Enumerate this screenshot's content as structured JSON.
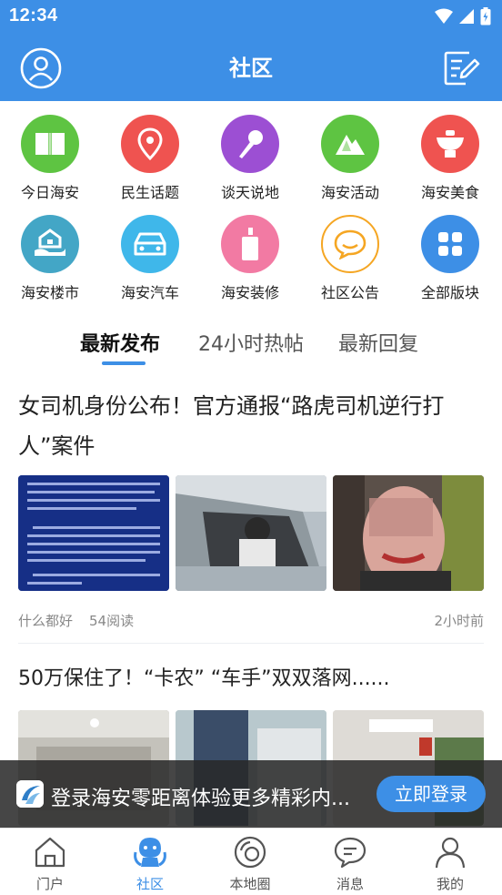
{
  "status_bar": {
    "time": "12:34"
  },
  "header": {
    "title": "社区"
  },
  "categories": [
    {
      "label": "今日海安",
      "icon": "book-icon",
      "color": "#5ec442"
    },
    {
      "label": "民生话题",
      "icon": "location-pin-icon",
      "color": "#ef5350"
    },
    {
      "label": "谈天说地",
      "icon": "microphone-icon",
      "color": "#9c4fd3"
    },
    {
      "label": "海安活动",
      "icon": "mountain-icon",
      "color": "#5ec442"
    },
    {
      "label": "海安美食",
      "icon": "food-bowl-icon",
      "color": "#ef5350"
    },
    {
      "label": "海安楼市",
      "icon": "house-hand-icon",
      "color": "#43a6c6"
    },
    {
      "label": "海安汽车",
      "icon": "car-icon",
      "color": "#3fb7ea"
    },
    {
      "label": "海安装修",
      "icon": "paint-tube-icon",
      "color": "#f27aa3"
    },
    {
      "label": "社区公告",
      "icon": "chat-bubble-icon",
      "color": "#f5a623"
    },
    {
      "label": "全部版块",
      "icon": "grid-icon",
      "color": "#3d8fe6"
    }
  ],
  "tabs": [
    {
      "label": "最新发布",
      "active": true
    },
    {
      "label": "24小时热帖",
      "active": false
    },
    {
      "label": "最新回复",
      "active": false
    }
  ],
  "articles": [
    {
      "title": "女司机身份公布！官方通报“路虎司机逆行打人”案件",
      "author": "什么都好",
      "views": "54阅读",
      "time": "2小时前"
    },
    {
      "title": "50万保住了！“卡农” “车手”双双落网......"
    }
  ],
  "login_banner": {
    "text": "登录海安零距离体验更多精彩内...",
    "button": "立即登录"
  },
  "bottom_nav": [
    {
      "label": "门户",
      "icon": "home-icon",
      "active": false
    },
    {
      "label": "社区",
      "icon": "community-icon",
      "active": true
    },
    {
      "label": "本地圈",
      "icon": "local-circle-icon",
      "active": false
    },
    {
      "label": "消息",
      "icon": "message-icon",
      "active": false
    },
    {
      "label": "我的",
      "icon": "profile-icon",
      "active": false
    }
  ],
  "colors": {
    "accent": "#3d8fe6",
    "banner_bg": "#282828"
  }
}
